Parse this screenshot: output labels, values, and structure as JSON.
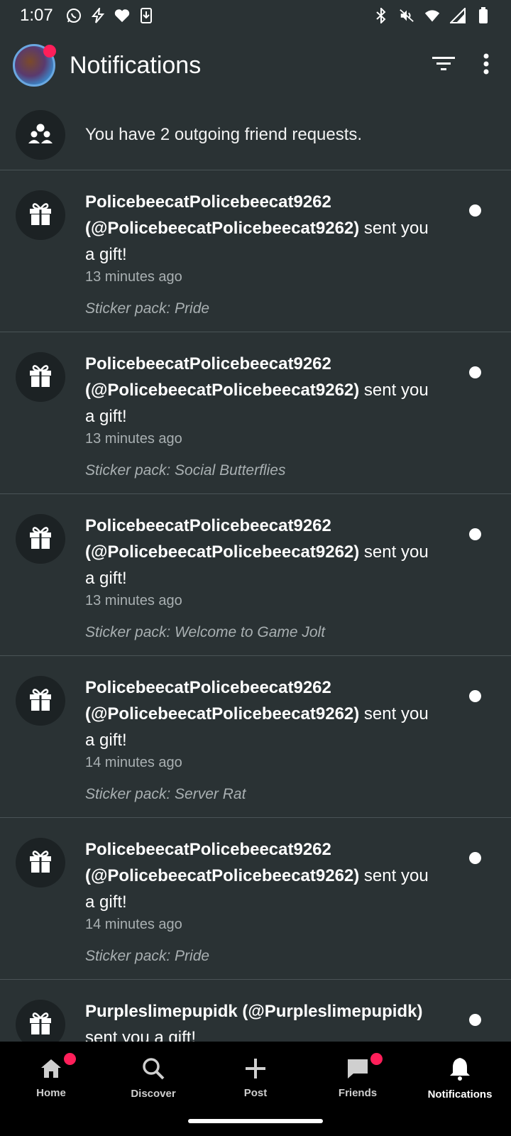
{
  "status_bar": {
    "time": "1:07",
    "left_icons": [
      "whatsapp-icon",
      "bolt-icon",
      "heart-icon",
      "download-icon"
    ],
    "right_icons": [
      "bluetooth-icon",
      "mute-icon",
      "wifi-icon",
      "signal-icon",
      "battery-icon"
    ]
  },
  "header": {
    "title": "Notifications",
    "avatar_badge": true,
    "filter_icon": "filter-icon",
    "more_icon": "more-vert-icon"
  },
  "friend_requests": {
    "text": "You have 2 outgoing friend requests.",
    "icon": "people-icon"
  },
  "notifications": [
    {
      "user": "PolicebeecatPolicebeecat9262 (@PolicebeecatPolicebeecat9262)",
      "action": " sent you a gift!",
      "time": "13 minutes ago",
      "sticker": "Sticker pack: Pride"
    },
    {
      "user": "PolicebeecatPolicebeecat9262 (@PolicebeecatPolicebeecat9262)",
      "action": " sent you a gift!",
      "time": "13 minutes ago",
      "sticker": "Sticker pack: Social Butterflies"
    },
    {
      "user": "PolicebeecatPolicebeecat9262 (@PolicebeecatPolicebeecat9262)",
      "action": " sent you a gift!",
      "time": "13 minutes ago",
      "sticker": "Sticker pack: Welcome to Game Jolt"
    },
    {
      "user": "PolicebeecatPolicebeecat9262 (@PolicebeecatPolicebeecat9262)",
      "action": " sent you a gift!",
      "time": "14 minutes ago",
      "sticker": "Sticker pack: Server Rat"
    },
    {
      "user": "PolicebeecatPolicebeecat9262 (@PolicebeecatPolicebeecat9262)",
      "action": " sent you a gift!",
      "time": "14 minutes ago",
      "sticker": "Sticker pack: Pride"
    },
    {
      "user": "Purpleslimepupidk (@Purpleslimepupidk)",
      "action": " sent you a gift!",
      "time": "",
      "sticker": ""
    }
  ],
  "bottom_nav": [
    {
      "label": "Home",
      "icon": "home-icon",
      "badge": true,
      "active": false
    },
    {
      "label": "Discover",
      "icon": "search-icon",
      "badge": false,
      "active": false
    },
    {
      "label": "Post",
      "icon": "plus-icon",
      "badge": false,
      "active": false
    },
    {
      "label": "Friends",
      "icon": "chat-icon",
      "badge": true,
      "active": false
    },
    {
      "label": "Notifications",
      "icon": "bell-icon",
      "badge": false,
      "active": true
    }
  ],
  "colors": {
    "background": "#2a3234",
    "icon_circle": "#1c2224",
    "badge": "#ff1f5a",
    "nav_background": "#000000",
    "muted_text": "#a9b0b2"
  }
}
